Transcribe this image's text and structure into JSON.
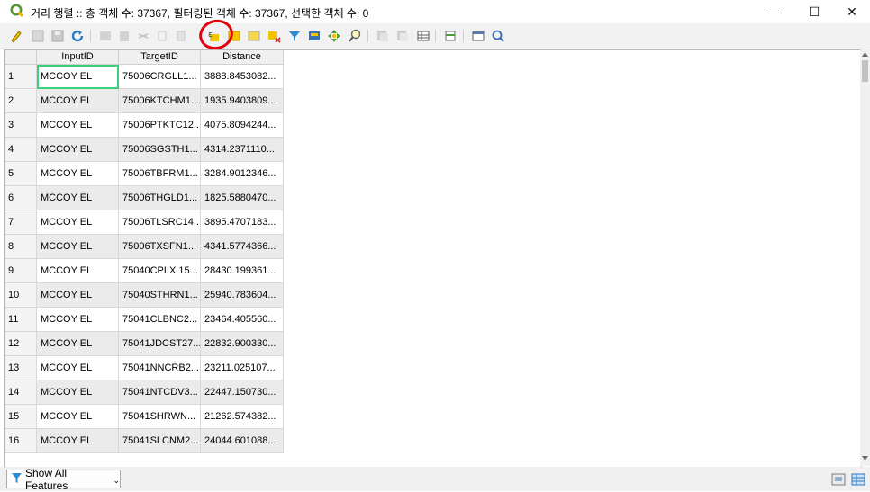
{
  "window": {
    "title": "거리 행렬 :: 총 객체 수: 37367, 필터링된 객체 수: 37367, 선택한 객체 수: 0",
    "minimize": "—",
    "maximize": "☐",
    "close": "✕"
  },
  "table": {
    "columns": [
      "InputID",
      "TargetID",
      "Distance"
    ],
    "rows": [
      {
        "n": "1",
        "input": "MCCOY EL",
        "target": "75006CRGLL1...",
        "distance": "3888.8453082..."
      },
      {
        "n": "2",
        "input": "MCCOY EL",
        "target": "75006KTCHM1...",
        "distance": "1935.9403809..."
      },
      {
        "n": "3",
        "input": "MCCOY EL",
        "target": "75006PTKTC12...",
        "distance": "4075.8094244..."
      },
      {
        "n": "4",
        "input": "MCCOY EL",
        "target": "75006SGSTH1...",
        "distance": "4314.2371110..."
      },
      {
        "n": "5",
        "input": "MCCOY EL",
        "target": "75006TBFRM1...",
        "distance": "3284.9012346..."
      },
      {
        "n": "6",
        "input": "MCCOY EL",
        "target": "75006THGLD1...",
        "distance": "1825.5880470..."
      },
      {
        "n": "7",
        "input": "MCCOY EL",
        "target": "75006TLSRC14...",
        "distance": "3895.4707183..."
      },
      {
        "n": "8",
        "input": "MCCOY EL",
        "target": "75006TXSFN1...",
        "distance": "4341.5774366..."
      },
      {
        "n": "9",
        "input": "MCCOY EL",
        "target": "75040CPLX 15...",
        "distance": "28430.199361..."
      },
      {
        "n": "10",
        "input": "MCCOY EL",
        "target": "75040STHRN1...",
        "distance": "25940.783604..."
      },
      {
        "n": "11",
        "input": "MCCOY EL",
        "target": "75041CLBNC2...",
        "distance": "23464.405560..."
      },
      {
        "n": "12",
        "input": "MCCOY EL",
        "target": "75041JDCST27...",
        "distance": "22832.900330..."
      },
      {
        "n": "13",
        "input": "MCCOY EL",
        "target": "75041NNCRB2...",
        "distance": "23211.025107..."
      },
      {
        "n": "14",
        "input": "MCCOY EL",
        "target": "75041NTCDV3...",
        "distance": "22447.150730..."
      },
      {
        "n": "15",
        "input": "MCCOY EL",
        "target": "75041SHRWN...",
        "distance": "21262.574382..."
      },
      {
        "n": "16",
        "input": "MCCOY EL",
        "target": "75041SLCNM2...",
        "distance": "24044.601088..."
      }
    ]
  },
  "status": {
    "filter_button": "Show All Features"
  },
  "colors": {
    "accent_selection": "#3ccf7a",
    "annotation_circle": "#e00010",
    "qgis_green": "#589632"
  }
}
